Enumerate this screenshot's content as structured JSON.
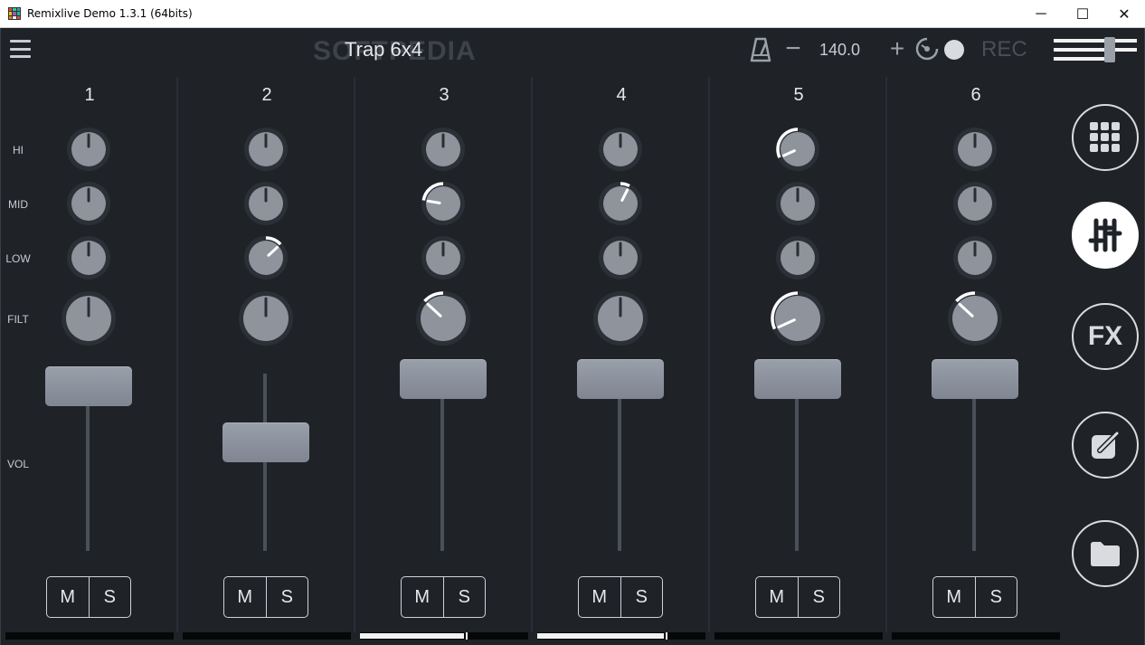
{
  "window": {
    "title": "Remixlive Demo 1.3.1 (64bits)",
    "minimize": "─",
    "maximize": "☐",
    "close": "✕"
  },
  "header": {
    "watermark": "SOFTPEDIA",
    "project_title": "Trap 6x4",
    "tempo_minus": "−",
    "tempo": "140.0",
    "tempo_plus": "+",
    "rec_label": "REC"
  },
  "row_labels": {
    "hi": "HI",
    "mid": "MID",
    "low": "LOW",
    "filt": "FILT",
    "vol": "VOL"
  },
  "channels": [
    {
      "number": "1",
      "hi": 0,
      "mid": 0,
      "low": 0,
      "filt": 0,
      "volume": 0.95,
      "level": 0.0,
      "mute": "M",
      "solo": "S"
    },
    {
      "number": "2",
      "hi": 0,
      "mid": 0,
      "low": 0.35,
      "filt": 0,
      "volume": 0.55,
      "level": 0.0,
      "mute": "M",
      "solo": "S"
    },
    {
      "number": "3",
      "hi": 0,
      "mid": -0.6,
      "low": 0,
      "filt": -0.35,
      "volume": 1.0,
      "level": 0.62,
      "mute": "M",
      "solo": "S"
    },
    {
      "number": "4",
      "hi": 0,
      "mid": 0.2,
      "low": 0,
      "filt": 0,
      "volume": 1.0,
      "level": 0.75,
      "mute": "M",
      "solo": "S"
    },
    {
      "number": "5",
      "hi": -0.85,
      "mid": 0,
      "low": 0,
      "filt": -0.85,
      "volume": 1.0,
      "level": 0.0,
      "mute": "M",
      "solo": "S"
    },
    {
      "number": "6",
      "hi": 0,
      "mid": 0,
      "low": 0,
      "filt": -0.35,
      "volume": 1.0,
      "level": 0.0,
      "mute": "M",
      "solo": "S"
    }
  ],
  "sidebar": {
    "fx_label": "FX",
    "active": "mixer"
  },
  "colors": {
    "background": "#1f2227",
    "knob": "#8e939c",
    "knob_ring": "#2c3036",
    "indicator": "#ffffff"
  }
}
